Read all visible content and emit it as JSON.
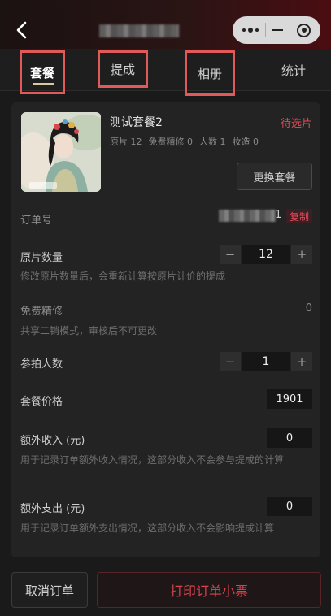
{
  "header": {
    "back_icon": "chevron-left-icon",
    "capsule_more_icon": "more-dots-icon",
    "capsule_minimize_icon": "minimize-icon",
    "capsule_close_icon": "target-close-icon"
  },
  "tabs": [
    {
      "label": "套餐",
      "active": true
    },
    {
      "label": "提成",
      "active": false
    },
    {
      "label": "相册",
      "active": false
    },
    {
      "label": "统计",
      "active": false
    }
  ],
  "package": {
    "name": "测试套餐2",
    "status": "待选片",
    "stats": [
      "原片 12",
      "免费精修 0",
      "人数 1",
      "妆造 0"
    ],
    "change_button": "更换套餐"
  },
  "order": {
    "label": "订单号",
    "number_tail": "1",
    "copy_button": "复制"
  },
  "original_count": {
    "label": "原片数量",
    "value": "12",
    "minus": "−",
    "plus": "+",
    "hint": "修改原片数量后，会重新计算按原片计价的提成"
  },
  "free_retouch": {
    "label": "免费精修",
    "value": "0",
    "hint": "共享二销模式，审核后不可更改"
  },
  "people": {
    "label": "参拍人数",
    "value": "1",
    "minus": "−",
    "plus": "+"
  },
  "price": {
    "label": "套餐价格",
    "value": "1901"
  },
  "extra_income": {
    "label": "额外收入 (元)",
    "value": "0",
    "hint": "用于记录订单额外收入情况，这部分收入不会参与提成的计算"
  },
  "extra_expense": {
    "label": "额外支出 (元)",
    "value": "0",
    "hint": "用于记录订单额外支出情况，这部分收入不会影响提成计算"
  },
  "bottom": {
    "cancel": "取消订单",
    "print": "打印订单小票"
  },
  "colors": {
    "accent_red": "#e04b55",
    "highlight_box": "#e15a5a",
    "background": "#1a1a1a",
    "card": "#232323"
  }
}
